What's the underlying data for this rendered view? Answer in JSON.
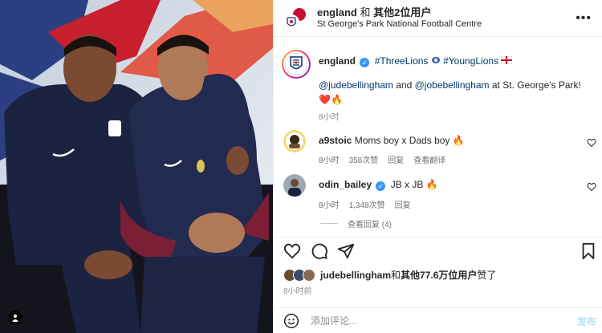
{
  "photo": {
    "alt": "Two England players in navy hoodies seated on a bench",
    "shirt_colors": {
      "navy": "#1b2340",
      "white": "#ffffff",
      "burgundy": "#7a1f35"
    }
  },
  "header": {
    "account": "england",
    "with_text": "和",
    "others": "其他2位用户",
    "location": "St George's Park National Football Centre",
    "more_icon": "more-horizontal-icon"
  },
  "post": {
    "username": "england",
    "hashtag1": "#ThreeLions",
    "hashtag2": "#YoungLions",
    "mention1": "@judebellingham",
    "and_text": "and",
    "mention2": "@jobebellingham",
    "tail_text": "at St. George's Park!",
    "emojis": "❤️🔥",
    "time": "8小时"
  },
  "comments": [
    {
      "username": "a9stoic",
      "text": "Moms boy x Dads boy 🔥",
      "time": "8小时",
      "likes": "358次赞",
      "reply": "回复",
      "translate": "查看翻译"
    },
    {
      "username": "odin_bailey",
      "verified": true,
      "text": "JB x JB 🔥",
      "time": "8小时",
      "likes": "1,348次赞",
      "reply": "回复"
    }
  ],
  "view_replies": "查看回复 (4)",
  "likes_summary": {
    "user": "judebellingham",
    "and_text": "和",
    "others": "其他77.6万位用户",
    "suffix": "赞了"
  },
  "likes_time": "8小时前",
  "comment_box": {
    "placeholder": "添加评论...",
    "post_label": "发布"
  },
  "colors": {
    "link": "#00376b",
    "verified": "#3897f0",
    "secondary_text": "#737373",
    "post_button_disabled": "#b2dffc"
  }
}
